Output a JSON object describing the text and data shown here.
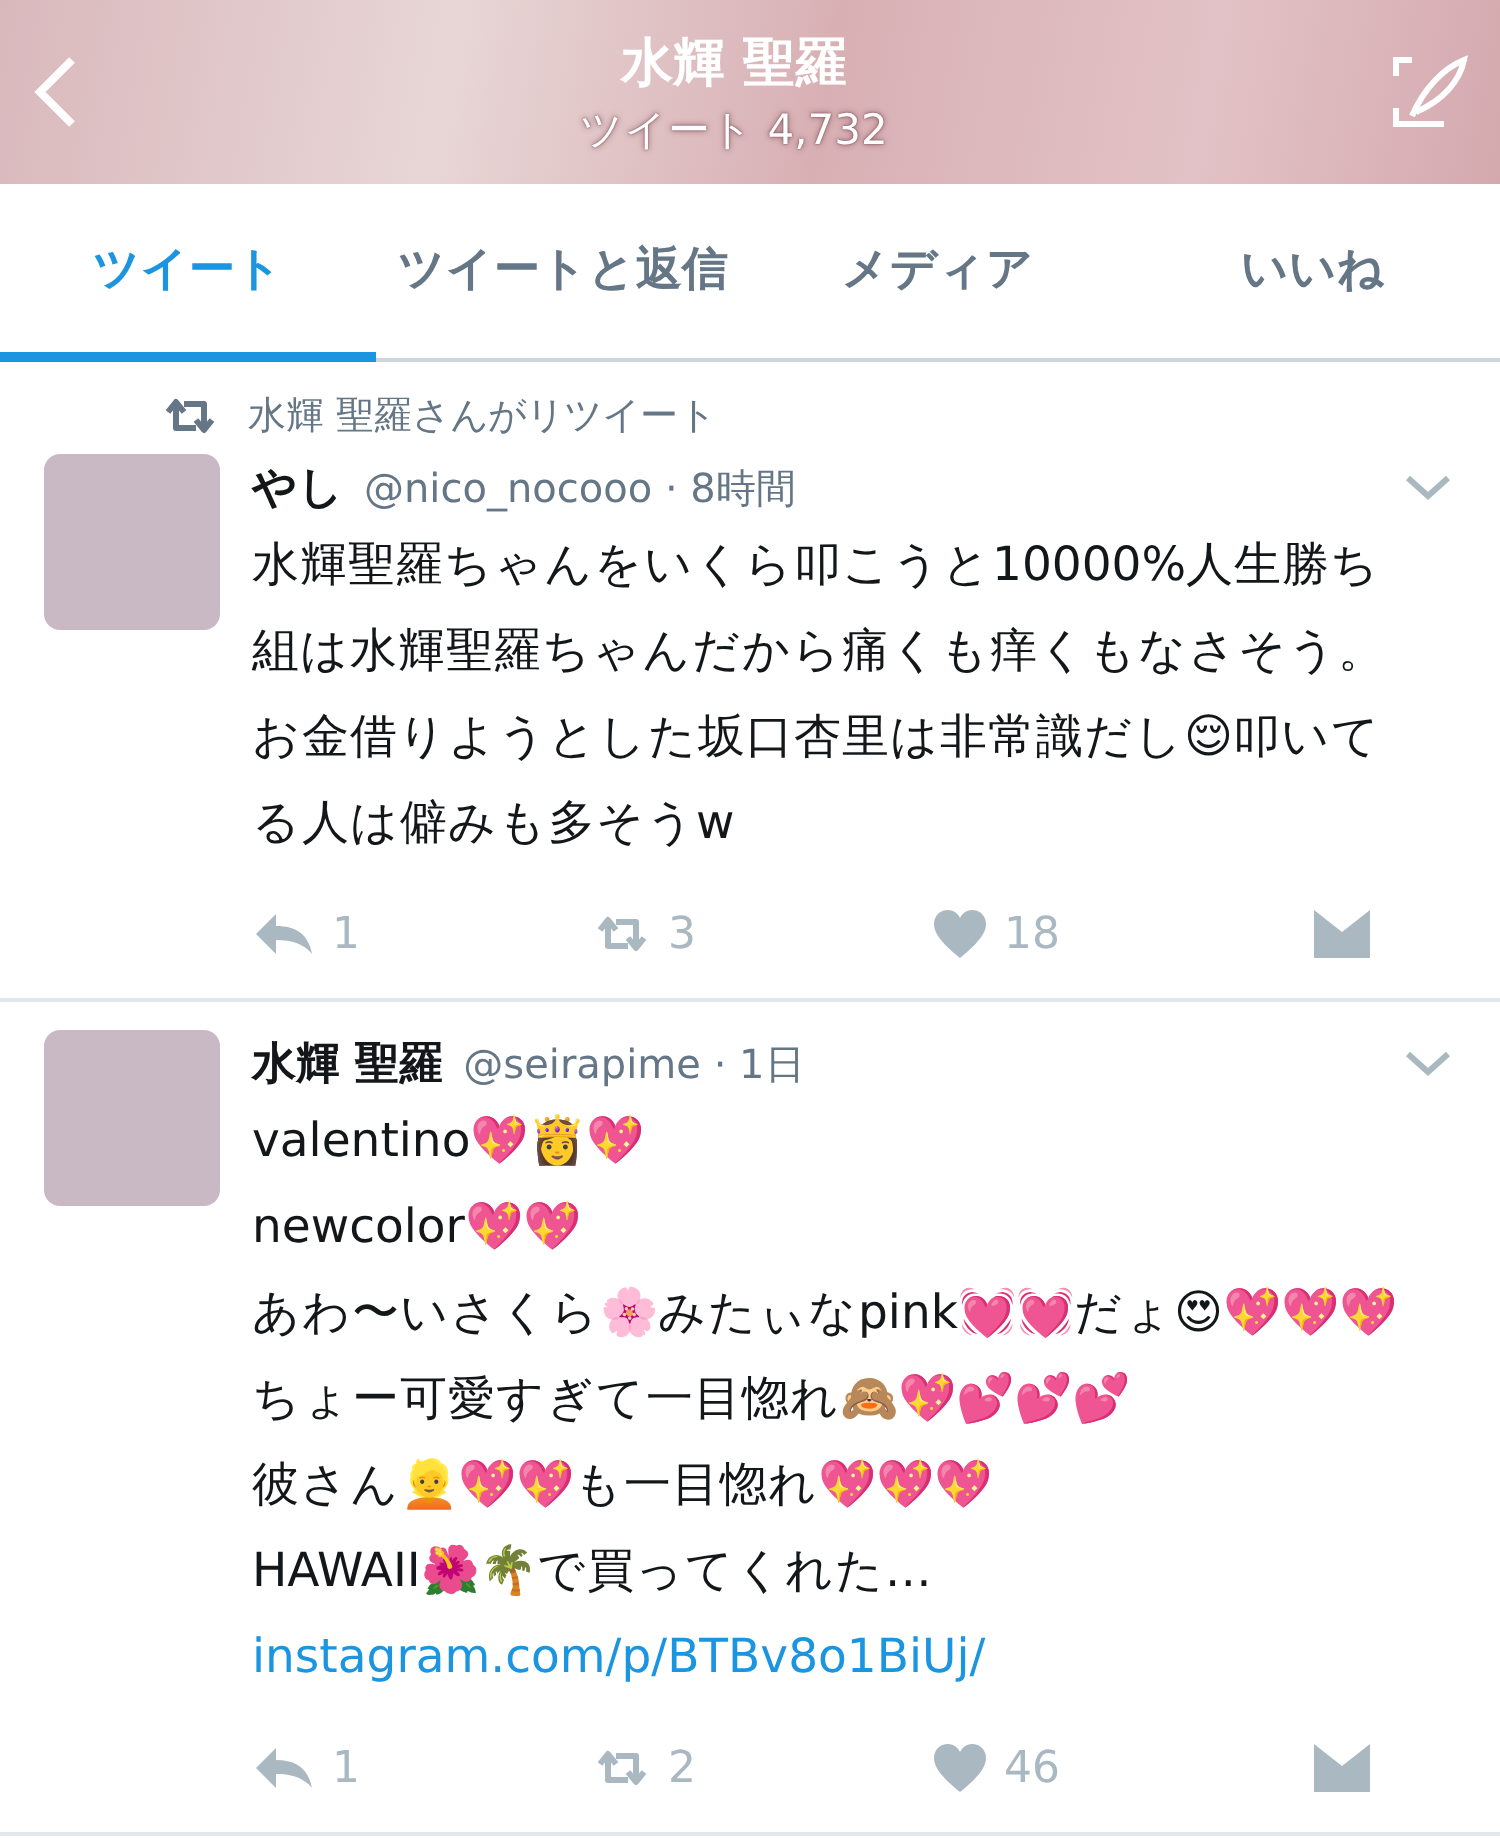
{
  "header": {
    "title": "水輝 聖羅",
    "subtitle": "ツイート 4,732"
  },
  "tabs": [
    {
      "label": "ツイート",
      "selected": true
    },
    {
      "label": "ツイートと返信",
      "selected": false
    },
    {
      "label": "メディア",
      "selected": false
    },
    {
      "label": "いいね",
      "selected": false
    }
  ],
  "tweets": [
    {
      "retweeted_by": "水輝 聖羅さんがリツイート",
      "name": "やし",
      "handle": "@nico_nocooo",
      "time": "· 8時間",
      "lines": [
        "水輝聖羅ちゃんをいくら叩こうと10000%人生勝ち組は水輝聖羅ちゃんだから痛くも痒くもなさそう。お金借りようとした坂口杏里は非常識だし😌叩いてる人は僻みも多そうw"
      ],
      "replies": "1",
      "retweets": "3",
      "likes": "18"
    },
    {
      "name": "水輝 聖羅",
      "handle": "@seirapime",
      "time": "· 1日",
      "lines": [
        "valentino💖👸💖",
        "newcolor💖💖",
        "あわ〜いさくら🌸みたぃなpink💓💓だょ😍💖💖💖",
        "ちょー可愛すぎて一目惚れ🙈💖💕💕💕",
        "彼さん👱💖💖も一目惚れ💖💖💖",
        "HAWAII🌺🌴で買ってくれた…"
      ],
      "link": "instagram.com/p/BTBv8o1BiUj/",
      "replies": "1",
      "retweets": "2",
      "likes": "46"
    }
  ]
}
